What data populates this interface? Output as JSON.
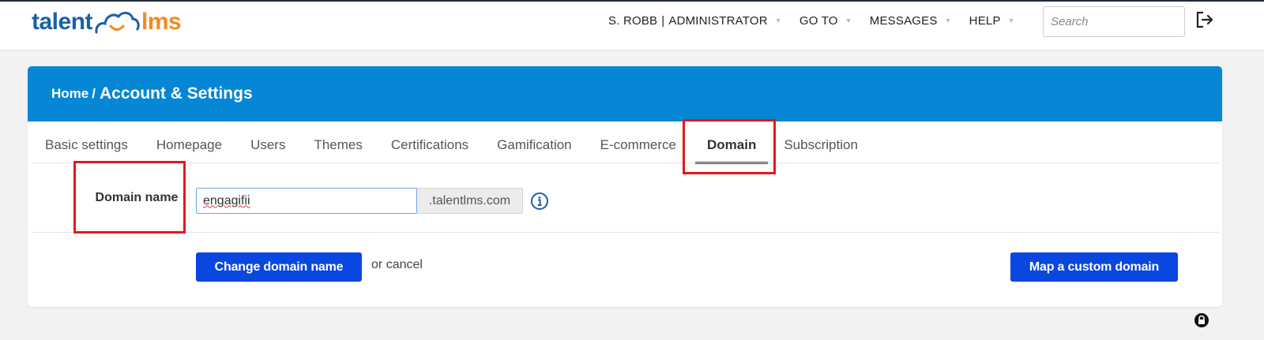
{
  "app": {
    "logo_part1": "talent",
    "logo_part2": "lms",
    "logo_icon": "cloud-smile-icon",
    "brand_blue": "#1b5fa8",
    "brand_orange": "#f28a1e"
  },
  "topnav": {
    "user_name": "S. ROBB",
    "separator": "|",
    "user_role": "ADMINISTRATOR",
    "goto_label": "GO TO",
    "messages_label": "MESSAGES",
    "help_label": "HELP",
    "search_placeholder": "Search",
    "logout_icon": "logout-icon"
  },
  "header": {
    "breadcrumb_home": "Home",
    "breadcrumb_separator": "/",
    "title": "Account & Settings",
    "color": "#0587d6"
  },
  "tabs": [
    {
      "label": "Basic settings",
      "active": false
    },
    {
      "label": "Homepage",
      "active": false
    },
    {
      "label": "Users",
      "active": false
    },
    {
      "label": "Themes",
      "active": false
    },
    {
      "label": "Certifications",
      "active": false
    },
    {
      "label": "Gamification",
      "active": false
    },
    {
      "label": "E-commerce",
      "active": false
    },
    {
      "label": "Domain",
      "active": true
    },
    {
      "label": "Subscription",
      "active": false
    }
  ],
  "domain_form": {
    "label": "Domain name",
    "value": "engagifii",
    "suffix": ".talentlms.com",
    "info_icon": "info-icon"
  },
  "actions": {
    "change_label": "Change domain name",
    "or_text": "or",
    "cancel_label": "cancel",
    "map_label": "Map a custom domain",
    "button_color": "#0a47e0"
  },
  "annotations": {
    "highlight_color": "#e8161c"
  },
  "footer": {
    "lock_icon": "lock-icon"
  }
}
